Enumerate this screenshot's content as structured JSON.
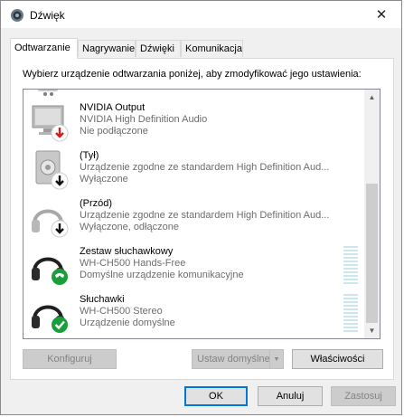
{
  "window": {
    "title": "Dźwięk",
    "close_glyph": "✕"
  },
  "tabs": [
    {
      "label": "Odtwarzanie",
      "active": true
    },
    {
      "label": "Nagrywanie",
      "active": false
    },
    {
      "label": "Dźwięki",
      "active": false
    },
    {
      "label": "Komunikacja",
      "active": false
    }
  ],
  "instruction": "Wybierz urządzenie odtwarzania poniżej, aby zmodyfikować jego ustawienia:",
  "devices": [
    {
      "name": "NVIDIA Output",
      "line1": "NVIDIA High Definition Audio",
      "line2": "Nie podłączone",
      "icon": "monitor-speaker-icon",
      "badge": "red-down-arrow-icon"
    },
    {
      "name": "(Tył)",
      "line1": "Urządzenie zgodne ze standardem High Definition Aud...",
      "line2": "Wyłączone",
      "icon": "speaker-icon",
      "badge": "black-down-arrow-icon"
    },
    {
      "name": "(Przód)",
      "line1": "Urządzenie zgodne ze standardem High Definition Aud...",
      "line2": "Wyłączone, odłączone",
      "icon": "headphones-icon",
      "badge": "black-down-arrow-icon"
    },
    {
      "name": "Zestaw słuchawkowy",
      "line1": "WH-CH500 Hands-Free",
      "line2": "Domyślne urządzenie komunikacyjne",
      "icon": "headset-icon",
      "badge": "green-phone-icon"
    },
    {
      "name": "Słuchawki",
      "line1": "WH-CH500 Stereo",
      "line2": "Urządzenie domyślne",
      "icon": "headphones-icon",
      "badge": "green-check-icon"
    }
  ],
  "buttons": {
    "configure": "Konfiguruj",
    "set_default": "Ustaw domyślne",
    "properties": "Właściwości",
    "ok": "OK",
    "cancel": "Anuluj",
    "apply": "Zastosuj"
  },
  "colors": {
    "accent": "#0078d7",
    "badge_green": "#1a9e3c",
    "badge_red": "#d21e1e",
    "level_meter": "#c9e7ec"
  }
}
